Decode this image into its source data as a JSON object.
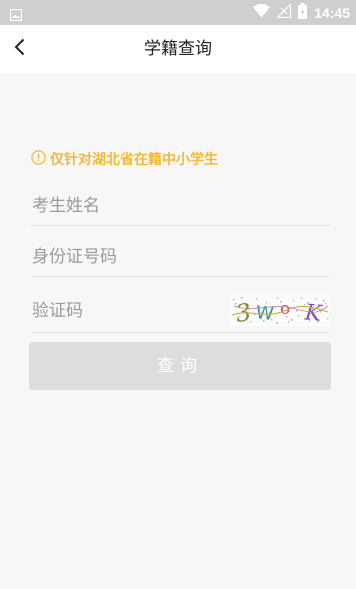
{
  "status_bar": {
    "time": "14:45",
    "icons": [
      "image-icon",
      "wifi-icon",
      "signal-icon",
      "battery-icon"
    ]
  },
  "app_bar": {
    "title": "学籍查询",
    "back_icon": "chevron-left-icon"
  },
  "notice": {
    "icon": "info-circle-icon",
    "text": "仅针对湖北省在籍中小学生",
    "color": "#f5b83d"
  },
  "form": {
    "name_placeholder": "考生姓名",
    "id_placeholder": "身份证号码",
    "captcha_placeholder": "验证码",
    "captcha_text": "3WoK"
  },
  "query_button": {
    "label": "查询",
    "background": "#dddddd"
  }
}
